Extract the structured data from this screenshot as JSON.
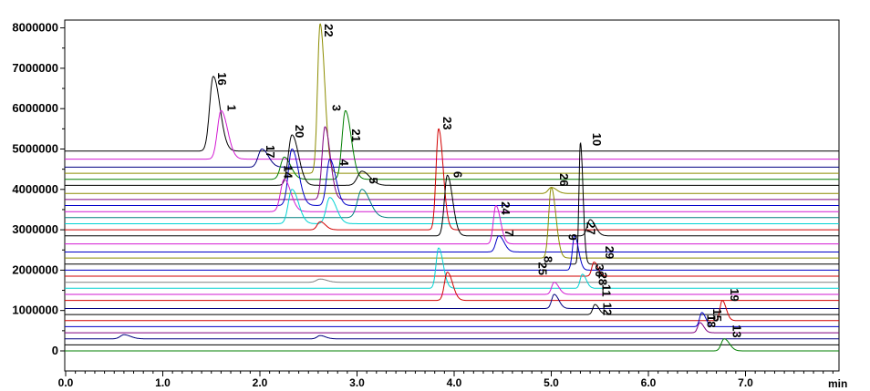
{
  "chart_data": {
    "type": "line",
    "xlabel": "min",
    "ylabel": "",
    "xlim": [
      0,
      8.0
    ],
    "ylim": [
      -500000,
      8100000
    ],
    "x_ticks": [
      0.0,
      1.0,
      2.0,
      3.0,
      4.0,
      5.0,
      6.0,
      7.0
    ],
    "x_tick_labels": [
      "0.0",
      "1.0",
      "2.0",
      "3.0",
      "4.0",
      "5.0",
      "6.0",
      "7.0"
    ],
    "y_ticks": [
      0,
      1000000,
      2000000,
      3000000,
      4000000,
      5000000,
      6000000,
      7000000,
      8000000
    ],
    "y_tick_labels": [
      "0",
      "1000000",
      "2000000",
      "3000000",
      "4000000",
      "5000000",
      "6000000",
      "7000000",
      "8000000"
    ],
    "grid": false,
    "colors": {
      "black": "#000000",
      "magenta": "#d21ad2",
      "olive": "#8c8c00",
      "green": "#007f00",
      "blue": "#0000c8",
      "cyan": "#00d2d2",
      "red": "#d20000",
      "navy": "#000080",
      "purple": "#800080",
      "darkcyan": "#008080",
      "gray": "#808080"
    },
    "series": [
      {
        "baseline": 4950000,
        "color": "black",
        "peaks": [
          {
            "x": 1.52,
            "h": 1850000,
            "w": 0.05
          }
        ]
      },
      {
        "baseline": 4750000,
        "color": "magenta",
        "peaks": [
          {
            "x": 1.6,
            "h": 1200000,
            "w": 0.05
          }
        ]
      },
      {
        "baseline": 4550000,
        "color": "navy",
        "peaks": [
          {
            "x": 2.02,
            "h": 450000,
            "w": 0.05
          }
        ]
      },
      {
        "baseline": 4400000,
        "color": "olive",
        "peaks": [
          {
            "x": 2.62,
            "h": 3700000,
            "w": 0.035
          }
        ]
      },
      {
        "baseline": 4250000,
        "color": "green",
        "peaks": [
          {
            "x": 2.25,
            "h": 550000,
            "w": 0.05
          },
          {
            "x": 2.88,
            "h": 1700000,
            "w": 0.045
          }
        ]
      },
      {
        "baseline": 4100000,
        "color": "black",
        "peaks": [
          {
            "x": 2.33,
            "h": 1250000,
            "w": 0.05
          },
          {
            "x": 3.05,
            "h": 350000,
            "w": 0.06
          }
        ]
      },
      {
        "baseline": 3900000,
        "color": "olive",
        "peaks": [
          {
            "x": 5.0,
            "h": 150000,
            "w": 0.04
          }
        ]
      },
      {
        "baseline": 3750000,
        "color": "purple",
        "peaks": [
          {
            "x": 2.67,
            "h": 1800000,
            "w": 0.04
          }
        ]
      },
      {
        "baseline": 3600000,
        "color": "blue",
        "peaks": [
          {
            "x": 2.33,
            "h": 1400000,
            "w": 0.05
          },
          {
            "x": 2.72,
            "h": 1150000,
            "w": 0.045
          }
        ]
      },
      {
        "baseline": 3450000,
        "color": "magenta",
        "peaks": [
          {
            "x": 2.25,
            "h": 800000,
            "w": 0.05
          }
        ]
      },
      {
        "baseline": 3300000,
        "color": "darkcyan",
        "peaks": [
          {
            "x": 3.05,
            "h": 700000,
            "w": 0.06
          }
        ]
      },
      {
        "baseline": 3150000,
        "color": "cyan",
        "peaks": [
          {
            "x": 2.33,
            "h": 850000,
            "w": 0.05
          },
          {
            "x": 2.72,
            "h": 650000,
            "w": 0.05
          }
        ]
      },
      {
        "baseline": 3000000,
        "color": "red",
        "peaks": [
          {
            "x": 2.62,
            "h": 200000,
            "w": 0.04
          },
          {
            "x": 3.84,
            "h": 2500000,
            "w": 0.035
          }
        ]
      },
      {
        "baseline": 2850000,
        "color": "black",
        "peaks": [
          {
            "x": 3.93,
            "h": 1500000,
            "w": 0.04
          },
          {
            "x": 5.4,
            "h": 400000,
            "w": 0.04
          }
        ]
      },
      {
        "baseline": 2650000,
        "color": "magenta",
        "peaks": [
          {
            "x": 4.43,
            "h": 950000,
            "w": 0.035
          }
        ]
      },
      {
        "baseline": 2450000,
        "color": "blue",
        "peaks": [
          {
            "x": 4.46,
            "h": 400000,
            "w": 0.04
          }
        ]
      },
      {
        "baseline": 2300000,
        "color": "olive",
        "peaks": [
          {
            "x": 5.0,
            "h": 1750000,
            "w": 0.035
          }
        ]
      },
      {
        "baseline": 2150000,
        "color": "black",
        "peaks": [
          {
            "x": 5.3,
            "h": 3000000,
            "w": 0.02
          }
        ]
      },
      {
        "baseline": 2000000,
        "color": "blue",
        "peaks": [
          {
            "x": 5.24,
            "h": 850000,
            "w": 0.03
          }
        ]
      },
      {
        "baseline": 1850000,
        "color": "red",
        "peaks": [
          {
            "x": 5.44,
            "h": 350000,
            "w": 0.03
          }
        ]
      },
      {
        "baseline": 1700000,
        "color": "gray",
        "peaks": [
          {
            "x": 2.62,
            "h": 80000,
            "w": 0.05
          }
        ]
      },
      {
        "baseline": 1550000,
        "color": "cyan",
        "peaks": [
          {
            "x": 3.84,
            "h": 1000000,
            "w": 0.035
          },
          {
            "x": 5.32,
            "h": 350000,
            "w": 0.03
          }
        ]
      },
      {
        "baseline": 1400000,
        "color": "magenta",
        "peaks": [
          {
            "x": 5.03,
            "h": 300000,
            "w": 0.035
          }
        ]
      },
      {
        "baseline": 1250000,
        "color": "red",
        "peaks": [
          {
            "x": 3.93,
            "h": 700000,
            "w": 0.04
          }
        ]
      },
      {
        "baseline": 1050000,
        "color": "navy",
        "peaks": [
          {
            "x": 5.03,
            "h": 350000,
            "w": 0.035
          }
        ]
      },
      {
        "baseline": 900000,
        "color": "black",
        "peaks": [
          {
            "x": 5.45,
            "h": 250000,
            "w": 0.03
          }
        ]
      },
      {
        "baseline": 750000,
        "color": "red",
        "peaks": [
          {
            "x": 6.76,
            "h": 500000,
            "w": 0.03
          }
        ]
      },
      {
        "baseline": 600000,
        "color": "blue",
        "peaks": [
          {
            "x": 6.55,
            "h": 350000,
            "w": 0.03
          }
        ]
      },
      {
        "baseline": 450000,
        "color": "purple",
        "peaks": [
          {
            "x": 6.53,
            "h": 250000,
            "w": 0.03
          }
        ]
      },
      {
        "baseline": 300000,
        "color": "navy",
        "peaks": [
          {
            "x": 0.6,
            "h": 100000,
            "w": 0.05
          },
          {
            "x": 2.62,
            "h": 80000,
            "w": 0.04
          }
        ]
      },
      {
        "baseline": 150000,
        "color": "black",
        "peaks": []
      },
      {
        "baseline": 0,
        "color": "green",
        "peaks": [
          {
            "x": 6.78,
            "h": 300000,
            "w": 0.04
          }
        ]
      }
    ],
    "peak_labels": [
      {
        "text": "16",
        "x": 1.52,
        "y": 6900000
      },
      {
        "text": "1",
        "x": 1.62,
        "y": 6100000
      },
      {
        "text": "17",
        "x": 2.02,
        "y": 5100000
      },
      {
        "text": "14",
        "x": 2.2,
        "y": 4600000
      },
      {
        "text": "20",
        "x": 2.32,
        "y": 5600000
      },
      {
        "text": "22",
        "x": 2.62,
        "y": 8100000
      },
      {
        "text": "3",
        "x": 2.7,
        "y": 6100000
      },
      {
        "text": "4",
        "x": 2.78,
        "y": 4750000
      },
      {
        "text": "21",
        "x": 2.9,
        "y": 5500000
      },
      {
        "text": "5",
        "x": 3.08,
        "y": 4300000
      },
      {
        "text": "23",
        "x": 3.84,
        "y": 5800000
      },
      {
        "text": "6",
        "x": 3.95,
        "y": 4450000
      },
      {
        "text": "24",
        "x": 4.44,
        "y": 3700000
      },
      {
        "text": "7",
        "x": 4.48,
        "y": 3000000
      },
      {
        "text": "25",
        "x": 4.82,
        "y": 2200000
      },
      {
        "text": "8",
        "x": 4.88,
        "y": 2350000
      },
      {
        "text": "26",
        "x": 5.04,
        "y": 4400000
      },
      {
        "text": "9",
        "x": 5.13,
        "y": 2900000
      },
      {
        "text": "10",
        "x": 5.38,
        "y": 5400000
      },
      {
        "text": "27",
        "x": 5.32,
        "y": 3200000
      },
      {
        "text": "30",
        "x": 5.41,
        "y": 2150000
      },
      {
        "text": "29",
        "x": 5.51,
        "y": 2600000
      },
      {
        "text": "28",
        "x": 5.44,
        "y": 1950000
      },
      {
        "text": "11",
        "x": 5.48,
        "y": 1650000
      },
      {
        "text": "12",
        "x": 5.49,
        "y": 1200000
      },
      {
        "text": "18",
        "x": 6.56,
        "y": 900000
      },
      {
        "text": "15",
        "x": 6.62,
        "y": 1050000
      },
      {
        "text": "19",
        "x": 6.8,
        "y": 1550000
      },
      {
        "text": "13",
        "x": 6.82,
        "y": 650000
      }
    ]
  }
}
